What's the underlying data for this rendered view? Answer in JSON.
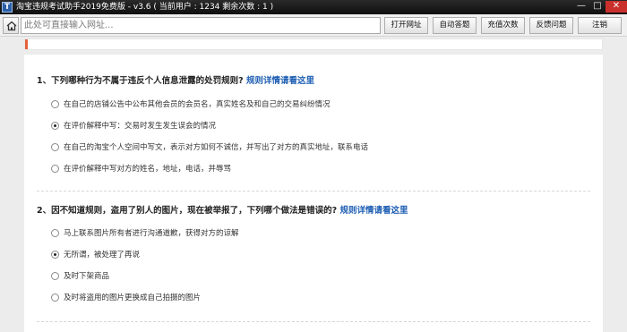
{
  "window": {
    "title": "淘宝违规考试助手2019免费版 - v3.6 ( 当前用户 : 1234  剩余次数 : 1 )",
    "icon": "T",
    "min_glyph": "—",
    "max_glyph": "□",
    "close_glyph": "✕"
  },
  "toolbar": {
    "url_placeholder": "此处可直接输入网址...",
    "url_value": "",
    "buttons": [
      "打开网址",
      "自动答题",
      "充值次数",
      "反馈问题",
      "注销"
    ]
  },
  "colors": {
    "accent": "#e4613a",
    "link": "#1f5fb3"
  },
  "questions": [
    {
      "number": "1、",
      "text": "下列哪种行为不属于违反个人信息泄露的处罚规则?",
      "link": "规则详情请看这里",
      "options": [
        {
          "text": "在自己的店铺公告中公布其他会员的会员名，真实姓名及和自己的交易纠纷情况",
          "checked": false
        },
        {
          "text": "在评价解释中写：交易时发生发生误会的情况",
          "checked": true
        },
        {
          "text": "在自己的淘宝个人空间中写文，表示对方如何不诚信，并写出了对方的真实地址，联系电话",
          "checked": false
        },
        {
          "text": "在评价解释中写对方的姓名，地址，电话，并辱骂",
          "checked": false
        }
      ]
    },
    {
      "number": "2、",
      "text": "因不知道规则，盗用了别人的图片，现在被举报了，下列哪个做法是错误的?",
      "link": "规则详情请看这里",
      "options": [
        {
          "text": "马上联系图片所有者进行沟通道歉，获得对方的谅解",
          "checked": false
        },
        {
          "text": "无所谓，被处理了再说",
          "checked": true
        },
        {
          "text": "及时下架商品",
          "checked": false
        },
        {
          "text": "及时将盗用的图片更换成自己拍摄的图片",
          "checked": false
        }
      ]
    }
  ]
}
